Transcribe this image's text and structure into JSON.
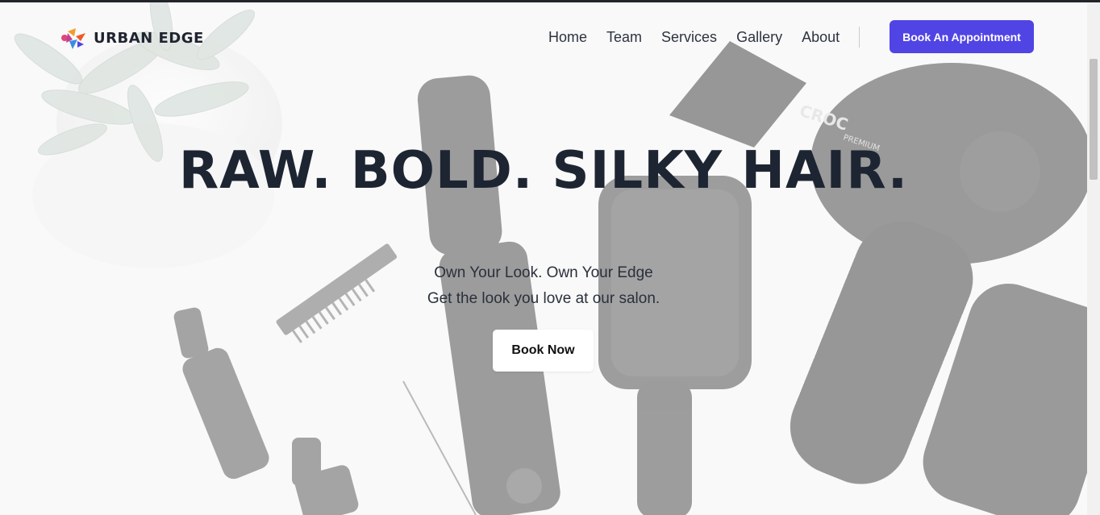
{
  "brand": {
    "name": "URBAN EDGE",
    "accent": "#5044e5"
  },
  "nav": {
    "items": [
      "Home",
      "Team",
      "Services",
      "Gallery",
      "About"
    ],
    "cta_label": "Book An Appointment"
  },
  "hero": {
    "headline": "RAW. BOLD. SILKY HAIR.",
    "subline_1": "Own Your Look. Own Your Edge",
    "subline_2": "Get the look you love at our salon.",
    "button_label": "Book Now",
    "image_text": {
      "dryer_brand": "CROC",
      "dryer_sub": "PREMIUM"
    }
  },
  "icons": {
    "logo": "urban-edge-logo-icon"
  }
}
